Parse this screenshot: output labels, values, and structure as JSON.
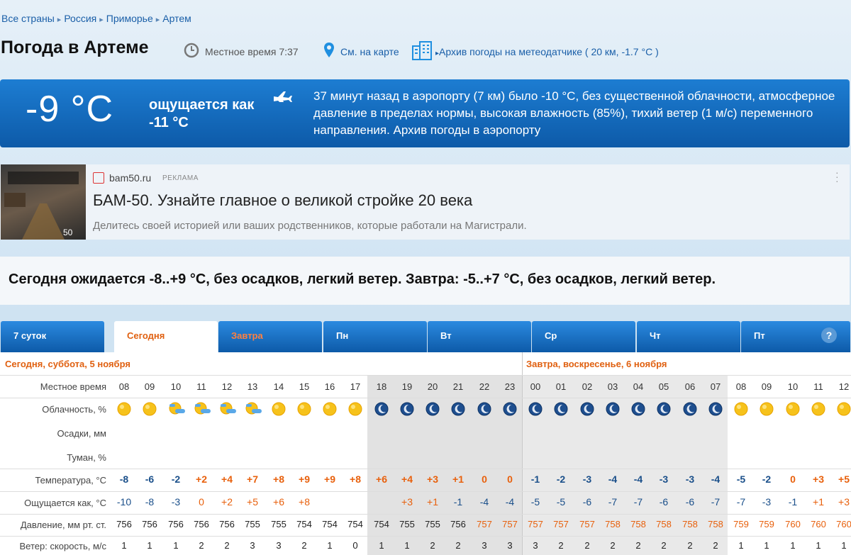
{
  "breadcrumb": [
    "Все страны",
    "Россия",
    "Приморье",
    "Артем"
  ],
  "page_title": "Погода в Артеме",
  "local_time_label": "Местное время  7:37",
  "map_link": "См. на карте",
  "archive_link": "Архив погоды на метеодатчике ( 20 км, -1.7 °C )",
  "current": {
    "temperature": "-9 °C",
    "feels_like": "ощущается как -11 °C",
    "airport_text": "37 минут назад в аэропорту (7 км) было -10 °C, без существенной облачности, атмосферное давление в пределах нормы, высокая влажность (85%), тихий ветер (1 м/с) переменного направления. Архив погоды в аэропорту"
  },
  "ad": {
    "site": "bam50.ru",
    "tag": "РЕКЛАМА",
    "title": "БАМ-50. Узнайте главное о великой стройке 20 века",
    "text": "Делитесь своей историей или ваших родственников, которые работали на Магистрали."
  },
  "summary": "Сегодня ожидается -8..+9 °C, без осадков, легкий ветер. Завтра: -5..+7 °C, без осадков, легкий ветер.",
  "tabs": [
    "7 суток",
    "Сегодня",
    "Завтра",
    "Пн",
    "Вт",
    "Ср",
    "Чт",
    "Пт"
  ],
  "help_label": "?",
  "day_headers": [
    "Сегодня, суббота, 5 ноября",
    "Завтра, воскресенье, 6 ноября"
  ],
  "row_labels": {
    "time": "Местное время",
    "clouds": "Облачность, %",
    "precip": "Осадки, мм",
    "fog": "Туман, %",
    "temp": "Температура, °C",
    "feels": "Ощущается как, °C",
    "pressure": "Давление, мм рт. ст.",
    "wind": "Ветер: скорость, м/с"
  },
  "hours": [
    "08",
    "09",
    "10",
    "11",
    "12",
    "13",
    "14",
    "15",
    "16",
    "17",
    "18",
    "19",
    "20",
    "21",
    "22",
    "23",
    "00",
    "01",
    "02",
    "03",
    "04",
    "05",
    "06",
    "07",
    "08",
    "09",
    "10",
    "11",
    "12"
  ],
  "icons": [
    "sun",
    "sun",
    "suncloud",
    "suncloud",
    "suncloud",
    "suncloud",
    "sun",
    "sun",
    "sun",
    "sun",
    "moon",
    "moon",
    "moon",
    "moon",
    "moon",
    "moon",
    "moon",
    "moon",
    "moon",
    "moon",
    "moon",
    "moon",
    "moon",
    "moon",
    "sun",
    "sun",
    "sun",
    "sun",
    "sun"
  ],
  "temps": [
    "-8",
    "-6",
    "-2",
    "+2",
    "+4",
    "+7",
    "+8",
    "+9",
    "+9",
    "+8",
    "+6",
    "+4",
    "+3",
    "+1",
    "0",
    "0",
    "-1",
    "-2",
    "-3",
    "-4",
    "-4",
    "-3",
    "-3",
    "-4",
    "-5",
    "-2",
    "0",
    "+3",
    "+5"
  ],
  "feels_values": [
    "-10",
    "-8",
    "-3",
    "0",
    "+2",
    "+5",
    "+6",
    "+8",
    "",
    "",
    "",
    "+3",
    "+1",
    "-1",
    "-4",
    "-4",
    "-5",
    "-5",
    "-6",
    "-7",
    "-7",
    "-6",
    "-6",
    "-7",
    "-7",
    "-3",
    "-1",
    "+1",
    "+3"
  ],
  "pressure": [
    "756",
    "756",
    "756",
    "756",
    "756",
    "755",
    "755",
    "754",
    "754",
    "754",
    "754",
    "755",
    "755",
    "756",
    "757",
    "757",
    "757",
    "757",
    "757",
    "758",
    "758",
    "758",
    "758",
    "758",
    "759",
    "759",
    "760",
    "760",
    "760"
  ],
  "wind": [
    "1",
    "1",
    "1",
    "2",
    "2",
    "3",
    "3",
    "2",
    "1",
    "0",
    "1",
    "1",
    "2",
    "2",
    "3",
    "3",
    "3",
    "2",
    "2",
    "2",
    "2",
    "2",
    "2",
    "2",
    "1",
    "1",
    "1",
    "1",
    "1"
  ],
  "colors": {
    "accent": "#e06010",
    "link": "#1a5fa8",
    "banner": "#1d7dd2",
    "neg": "#1a4f8a",
    "pos": "#e8600c"
  }
}
